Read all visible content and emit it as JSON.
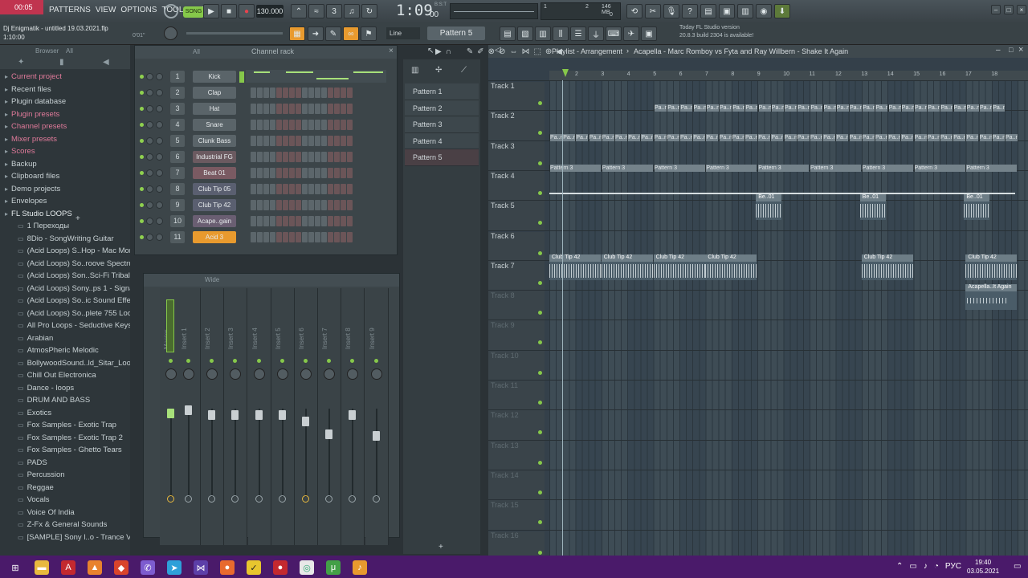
{
  "app": {
    "version_hint": "00:05",
    "project_file": "Dj Enigmatik - untitled 19.03.2021.flp",
    "hint_time": "1:10:00",
    "hint_counter": "0'01\""
  },
  "menu": [
    "FILE",
    "EDIT",
    "ADD",
    "PATTERNS",
    "VIEW",
    "OPTIONS",
    "TOOLS",
    "HELP"
  ],
  "transport": {
    "mode": "SONG",
    "tempo": "130.000",
    "time": "1:09",
    "time_sub": "00",
    "time_unit": "B:S:T",
    "memory": "146 MB",
    "cpu_a": "1",
    "cpu_b": "2",
    "cpu_c": "0"
  },
  "toolbar2": {
    "snap": "Line",
    "pattern": "Pattern 5",
    "news_title": "Today  FL Studio version",
    "news_body": "20.8.3 build 2304 is available!"
  },
  "browser": {
    "title": "Browser",
    "filter": "All",
    "items": [
      {
        "label": "Current project",
        "color": "#e07a9a",
        "indent": 0
      },
      {
        "label": "Recent files",
        "color": "#c7d0d3",
        "indent": 0
      },
      {
        "label": "Plugin database",
        "color": "#c7d0d3",
        "indent": 0
      },
      {
        "label": "Plugin presets",
        "color": "#e07a9a",
        "indent": 0
      },
      {
        "label": "Channel presets",
        "color": "#e07a9a",
        "indent": 0
      },
      {
        "label": "Mixer presets",
        "color": "#e07a9a",
        "indent": 0
      },
      {
        "label": "Scores",
        "color": "#e07a9a",
        "indent": 0
      },
      {
        "label": "Backup",
        "color": "#c7d0d3",
        "indent": 0
      },
      {
        "label": "Clipboard files",
        "color": "#c7d0d3",
        "indent": 0
      },
      {
        "label": "Demo projects",
        "color": "#c7d0d3",
        "indent": 0
      },
      {
        "label": "Envelopes",
        "color": "#c7d0d3",
        "indent": 0
      },
      {
        "label": "FL Studio LOOPS",
        "color": "#e6ecee",
        "indent": 0
      },
      {
        "label": "1 Переходы",
        "color": "#c7d0d3",
        "indent": 1
      },
      {
        "label": "8Dio - SongWriting Guitar",
        "color": "#c7d0d3",
        "indent": 1
      },
      {
        "label": "(Acid Loops) S..Hop - Mac Money",
        "color": "#c7d0d3",
        "indent": 1
      },
      {
        "label": "(Acid Loops) So..roove Spectrum",
        "color": "#c7d0d3",
        "indent": 1
      },
      {
        "label": "(Acid Loops) Son..Sci-Fi Tribal(1)",
        "color": "#c7d0d3",
        "indent": 1
      },
      {
        "label": "(Acid Loops) Sony..ps 1 - Signals I",
        "color": "#c7d0d3",
        "indent": 1
      },
      {
        "label": "(Acid Loops) So..ic Sound Effects",
        "color": "#c7d0d3",
        "indent": 1
      },
      {
        "label": "(Acid Loops) So..plete 755 Loops)",
        "color": "#c7d0d3",
        "indent": 1
      },
      {
        "label": "All Pro Loops - Seductive Keys 8",
        "color": "#c7d0d3",
        "indent": 1
      },
      {
        "label": "Arabian",
        "color": "#c7d0d3",
        "indent": 1
      },
      {
        "label": "AtmosPheric Melodic",
        "color": "#c7d0d3",
        "indent": 1
      },
      {
        "label": "BollywoodSound..ld_Sitar_Loops",
        "color": "#c7d0d3",
        "indent": 1
      },
      {
        "label": "Chill Out Electronica",
        "color": "#c7d0d3",
        "indent": 1
      },
      {
        "label": "Dance - loops",
        "color": "#c7d0d3",
        "indent": 1
      },
      {
        "label": "DRUM AND BASS",
        "color": "#c7d0d3",
        "indent": 1
      },
      {
        "label": "Exotics",
        "color": "#c7d0d3",
        "indent": 1
      },
      {
        "label": "Fox Samples - Exotic Trap",
        "color": "#c7d0d3",
        "indent": 1
      },
      {
        "label": "Fox Samples - Exotic Trap 2",
        "color": "#c7d0d3",
        "indent": 1
      },
      {
        "label": "Fox Samples - Ghetto Tears",
        "color": "#c7d0d3",
        "indent": 1
      },
      {
        "label": "PADS",
        "color": "#c7d0d3",
        "indent": 1
      },
      {
        "label": "Percussion",
        "color": "#c7d0d3",
        "indent": 1
      },
      {
        "label": "Reggae",
        "color": "#c7d0d3",
        "indent": 1
      },
      {
        "label": "Vocals",
        "color": "#c7d0d3",
        "indent": 1
      },
      {
        "label": "Voice Of India",
        "color": "#c7d0d3",
        "indent": 1
      },
      {
        "label": "Z-Fx & General Sounds",
        "color": "#c7d0d3",
        "indent": 1
      },
      {
        "label": "[SAMPLE] Sony l..o - Trance Vol 2",
        "color": "#c7d0d3",
        "indent": 1
      }
    ]
  },
  "channel_rack": {
    "title": "Channel rack",
    "filter": "All",
    "channels": [
      {
        "num": "1",
        "name": "Kick",
        "color": "#5a6469"
      },
      {
        "num": "2",
        "name": "Clap",
        "color": "#5a6469"
      },
      {
        "num": "3",
        "name": "Hat",
        "color": "#5a6469"
      },
      {
        "num": "4",
        "name": "Snare",
        "color": "#5a6469"
      },
      {
        "num": "5",
        "name": "Clunk Bass",
        "color": "#5a6469"
      },
      {
        "num": "6",
        "name": "Industrial FG",
        "color": "#6b5a60"
      },
      {
        "num": "7",
        "name": "Beat 01",
        "color": "#7a5a62"
      },
      {
        "num": "8",
        "name": "Club Tip 05",
        "color": "#5a5f70"
      },
      {
        "num": "9",
        "name": "Club Tip 42",
        "color": "#5a5f70"
      },
      {
        "num": "10",
        "name": "Acape..gain",
        "color": "#6a5e72"
      },
      {
        "num": "11",
        "name": "Acid 3",
        "color": "#e89a2e"
      }
    ]
  },
  "mixer": {
    "view": "Wide",
    "strips": [
      "Master",
      "Insert 1",
      "Insert 2",
      "Insert 3",
      "Insert 4",
      "Insert 5",
      "Insert 6",
      "Insert 7",
      "Insert 8",
      "Insert 9"
    ]
  },
  "picker": {
    "patterns": [
      "Pattern 1",
      "Pattern 2",
      "Pattern 3",
      "Pattern 4",
      "Pattern 5"
    ]
  },
  "playlist": {
    "title": "Playlist - Arrangement",
    "crumb_sep": "›",
    "song": "Acapella - Marc Romboy vs Fyta and Ray Willbern - Shake It Again",
    "bars": [
      "2",
      "3",
      "4",
      "5",
      "6",
      "7",
      "8",
      "9",
      "10",
      "11",
      "12",
      "13",
      "14",
      "15",
      "16",
      "17",
      "18"
    ],
    "tracks": [
      "Track 1",
      "Track 2",
      "Track 3",
      "Track 4",
      "Track 5",
      "Track 6",
      "Track 7",
      "Track 8",
      "Track 9",
      "Track 10",
      "Track 11",
      "Track 12",
      "Track 13",
      "Track 14",
      "Track 15",
      "Track 16"
    ],
    "clip_labels": {
      "t1": "Pa..n 1",
      "t2": "Pa..n 2",
      "t3": "Pattern 3",
      "t4": "Be..01",
      "t6": "Club Tip 42",
      "t7": "Acapella..It Again"
    }
  },
  "taskbar": {
    "lang": "РУС",
    "time": "19:40",
    "date": "03.05.2021"
  }
}
